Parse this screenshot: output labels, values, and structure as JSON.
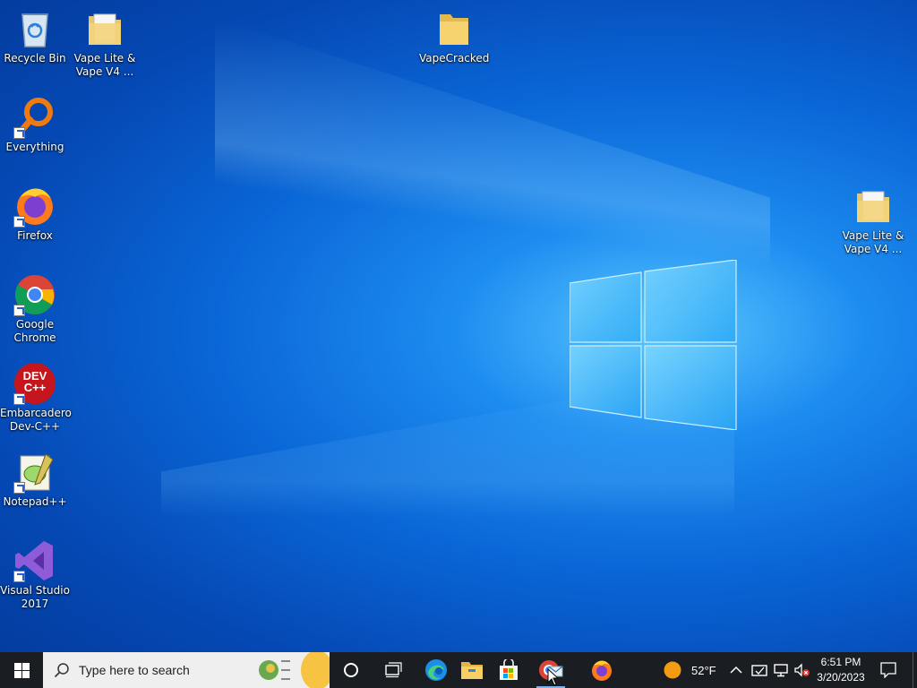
{
  "desktop": {
    "icons": [
      {
        "label": "Recycle Bin"
      },
      {
        "label": "Vape Lite & Vape V4 ..."
      },
      {
        "label": "VapeCracked"
      },
      {
        "label": "Everything"
      },
      {
        "label": "Firefox"
      },
      {
        "label": "Google Chrome"
      },
      {
        "label": "Embarcadero Dev-C++"
      },
      {
        "label": "Notepad++"
      },
      {
        "label": "Visual Studio 2017"
      },
      {
        "label": "Vape Lite & Vape V4 ..."
      }
    ],
    "devcpp_badge_text": "DEV C++"
  },
  "taskbar": {
    "search_placeholder": "Type here to search",
    "pinned": [
      "Edge",
      "File Explorer",
      "Microsoft Store",
      "Mail",
      "Firefox"
    ],
    "weather": {
      "temp": "52°F"
    },
    "clock": {
      "time": "6:51 PM",
      "date": "3/20/2023"
    }
  },
  "colors": {
    "taskbar_bg": "#1a1d22",
    "accent": "#0078d7"
  }
}
